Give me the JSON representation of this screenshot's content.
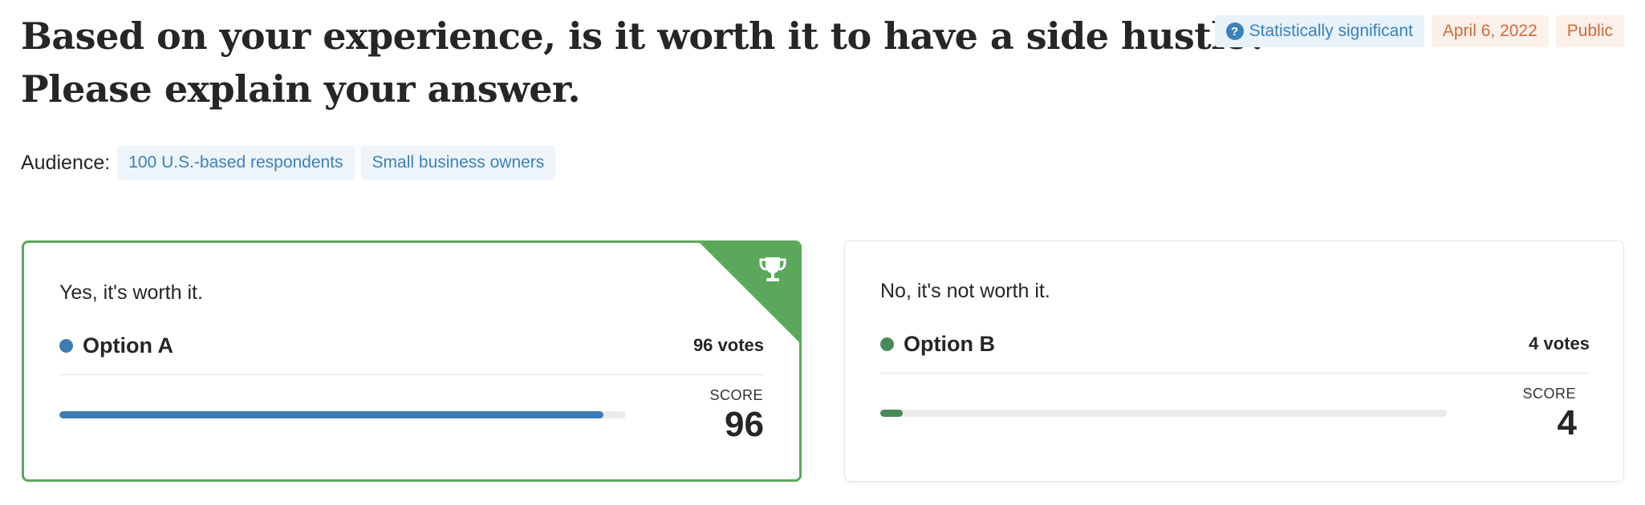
{
  "question": {
    "line1": "Based on your experience, is it worth it to have a side hustle?",
    "line2": "Please explain your answer."
  },
  "badges": {
    "significance": "Statistically significant",
    "date": "April 6, 2022",
    "visibility": "Public"
  },
  "audience": {
    "label": "Audience:",
    "tags": [
      "100 U.S.-based respondents",
      "Small business owners"
    ]
  },
  "options": [
    {
      "answer": "Yes, it's worth it.",
      "name": "Option A",
      "votes": "96 votes",
      "score_label": "SCORE",
      "score": "96",
      "fraction": 0.96,
      "color": "#3a7db3",
      "winner": true
    },
    {
      "answer": "No, it's not worth it.",
      "name": "Option B",
      "votes": "4 votes",
      "score_label": "SCORE",
      "score": "4",
      "fraction": 0.04,
      "color": "#4a8a5a",
      "winner": false
    }
  ],
  "colors": {
    "winner_accent": "#5ba85a",
    "link_blue": "#3a82bd",
    "orange": "#d06b3e"
  },
  "icons": {
    "significance": "question-circle-icon",
    "winner": "trophy-icon"
  }
}
